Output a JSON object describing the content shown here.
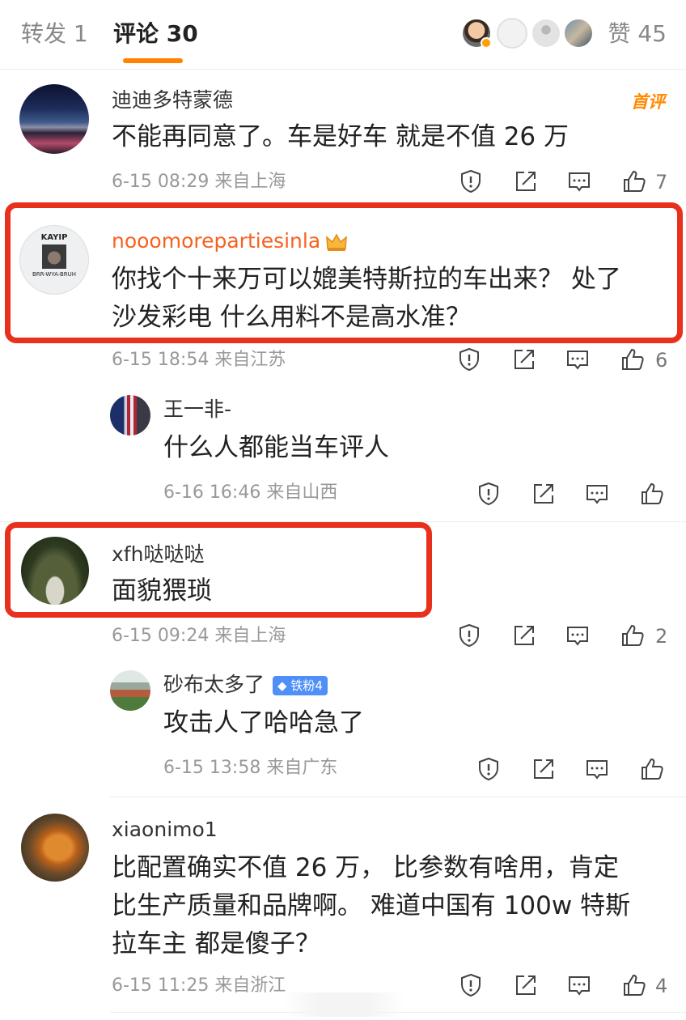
{
  "tabs": {
    "repost": "转发 1",
    "comments": "评论 30",
    "likes": "赞 45"
  },
  "colors": {
    "accent": "#ff8200",
    "username_highlight": "#f86120",
    "highlight_box": "#e8311d",
    "fan_badge": "#4f8ff7"
  },
  "comments": [
    {
      "user": "迪迪多特蒙德",
      "badge": "首评",
      "lines": [
        "不能再同意了。车是好车 就是不值 26 万"
      ],
      "time": "6-15 08:29",
      "location": "来自上海",
      "likes": "7"
    },
    {
      "user": "nooomorepartiesinla",
      "lines": [
        "你找个十来万可以媲美特斯拉的车出来？ 处了",
        "沙发彩电 什么用料不是高水准？"
      ],
      "time": "6-15 18:54",
      "location": "来自江苏",
      "likes": "6",
      "avatar_text_top": "KAYIP",
      "avatar_text_bottom": "BRR-WYA-BRUH"
    },
    {
      "user": "王一非-",
      "lines": [
        "什么人都能当车评人"
      ],
      "time": "6-16 16:46",
      "location": "来自山西",
      "likes": ""
    },
    {
      "user": "xfh哒哒哒",
      "lines": [
        "面貌猥琐"
      ],
      "time": "6-15 09:24",
      "location": "来自上海",
      "likes": "2"
    },
    {
      "user": "砂布太多了",
      "badge": "铁粉4",
      "lines": [
        "攻击人了哈哈急了"
      ],
      "time": "6-15 13:58",
      "location": "来自广东",
      "likes": ""
    },
    {
      "user": "xiaonimo1",
      "lines": [
        "比配置确实不值 26 万，  比参数有啥用，肯定",
        "比生产质量和品牌啊。 难道中国有 100w 特斯",
        "拉车主 都是傻子？"
      ],
      "time": "6-15 11:25",
      "location": "来自浙江",
      "likes": "4"
    }
  ],
  "icons": [
    "report-icon",
    "repost-icon",
    "comment-icon",
    "thumbs-up-icon",
    "crown-icon",
    "diamond-icon"
  ]
}
